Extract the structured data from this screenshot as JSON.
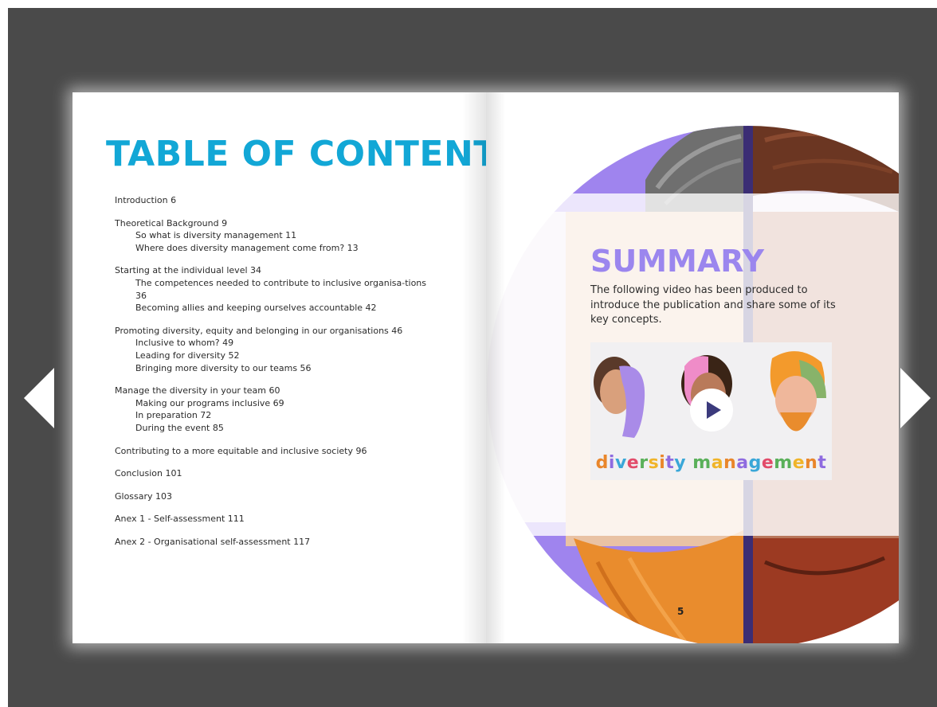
{
  "left_page": {
    "title": "TABLE OF CONTENTS",
    "sections": [
      {
        "lines": [
          {
            "text": "Introduction 6",
            "sub": false
          }
        ]
      },
      {
        "lines": [
          {
            "text": "Theoretical Background 9",
            "sub": false
          },
          {
            "text": "So what is diversity management 11",
            "sub": true
          },
          {
            "text": "Where does diversity management come from? 13",
            "sub": true
          }
        ]
      },
      {
        "lines": [
          {
            "text": "Starting at the individual level 34",
            "sub": false
          },
          {
            "text": "The competences needed to contribute to inclusive organisa-tions 36",
            "sub": true,
            "wrap": true
          },
          {
            "text": "Becoming allies and keeping ourselves accountable 42",
            "sub": true
          }
        ]
      },
      {
        "lines": [
          {
            "text": "Promoting diversity, equity and belonging in our organisations 46",
            "sub": false
          },
          {
            "text": "Inclusive to whom? 49",
            "sub": true
          },
          {
            "text": "Leading for diversity 52",
            "sub": true
          },
          {
            "text": "Bringing more diversity to our teams 56",
            "sub": true
          }
        ]
      },
      {
        "lines": [
          {
            "text": "Manage the diversity in your team 60",
            "sub": false
          },
          {
            "text": "Making our programs inclusive 69",
            "sub": true
          },
          {
            "text": "In preparation 72",
            "sub": true
          },
          {
            "text": "During the event 85",
            "sub": true
          }
        ]
      },
      {
        "lines": [
          {
            "text": "Contributing to a more equitable and inclusive society 96",
            "sub": false
          }
        ]
      },
      {
        "lines": [
          {
            "text": "Conclusion 101",
            "sub": false
          }
        ]
      },
      {
        "lines": [
          {
            "text": "Glossary 103",
            "sub": false
          }
        ]
      },
      {
        "lines": [
          {
            "text": "Anex 1 - Self-assessment 111",
            "sub": false
          }
        ]
      },
      {
        "lines": [
          {
            "text": "Anex 2 - Organisational self-assessment 117",
            "sub": false
          }
        ]
      }
    ]
  },
  "right_page": {
    "title": "SUMMARY",
    "text": "The following video has been produced to introduce the publication and share some of its key concepts.",
    "video": {
      "caption": "diversity management",
      "play_icon": "play-icon"
    },
    "page_number": "5"
  },
  "nav": {
    "prev_icon": "arrow-left-icon",
    "next_icon": "arrow-right-icon"
  },
  "colors": {
    "viewer_bg": "#4a4a4a",
    "toc_title": "#12a7d6",
    "summary_title": "#9b86ee",
    "arrow": "#ffffff"
  }
}
